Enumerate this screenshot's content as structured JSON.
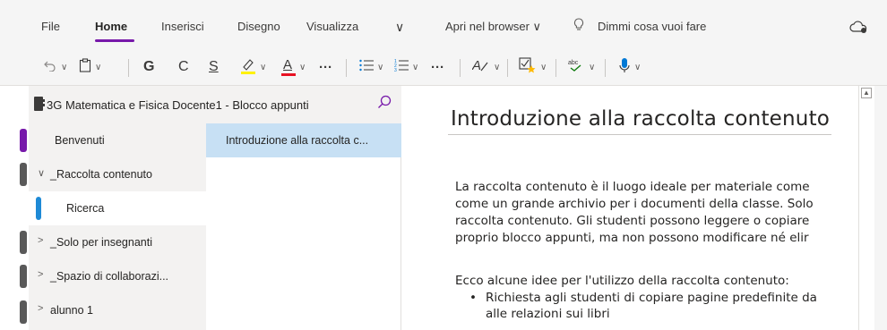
{
  "tabs": {
    "file": "File",
    "home": "Home",
    "insert": "Inserisci",
    "draw": "Disegno",
    "view": "Visualizza",
    "more_chevron": "∨",
    "open_browser": "Apri nel browser ∨",
    "tell_me": "Dimmi cosa vuoi fare"
  },
  "toolbar": {
    "undo_icon": "undo-icon",
    "clipboard_icon": "clipboard-icon",
    "bold": "G",
    "italic": "C",
    "underline": "S",
    "more": "···",
    "more2": "···"
  },
  "notebook": {
    "title": "3G Matematica e Fisica Docente1 - Blocco appunti"
  },
  "sections": [
    {
      "label": "Benvenuti"
    },
    {
      "label": "_Raccolta contenuto",
      "chevron": "∨"
    },
    {
      "label": "Ricerca"
    },
    {
      "label": "_Solo per insegnanti",
      "chevron": ">"
    },
    {
      "label": "_Spazio di collaborazi...",
      "chevron": ">"
    },
    {
      "label": "alunno 1",
      "chevron": ">"
    }
  ],
  "pages": [
    {
      "label": "Introduzione alla raccolta c..."
    }
  ],
  "page": {
    "title": "Introduzione alla raccolta contenuto",
    "paragraph": [
      "La raccolta contenuto è il luogo ideale per materiale come",
      "come un grande archivio per i documenti della classe. Solo",
      "raccolta contenuto. Gli studenti possono leggere o copiare",
      "proprio blocco appunti, ma non possono modificare né elir"
    ],
    "ideas_heading": "Ecco alcune idee per l'utilizzo della raccolta contenuto:",
    "bullets": [
      "Richiesta agli studenti di copiare pagine predefinite da",
      "alle relazioni sui libri"
    ]
  },
  "colors": {
    "accent": "#7719aa",
    "page_selected": "#c7e0f4",
    "section_tab_blue": "#1e8ad6",
    "font_color_red": "#e81123",
    "highlight_yellow": "#fff100"
  }
}
